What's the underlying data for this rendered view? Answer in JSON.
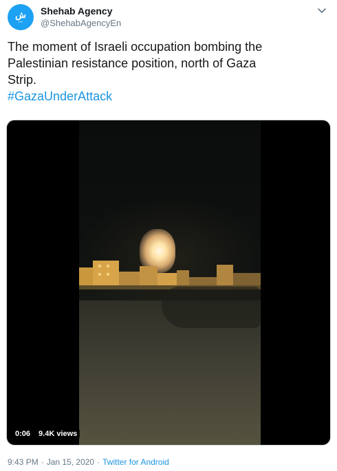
{
  "author": {
    "name": "Shehab Agency",
    "handle": "@ShehabAgencyEn",
    "avatar_icon": "shehab-logo-icon",
    "avatar_color": "#1da1f2"
  },
  "more_icon": "chevron-down-icon",
  "tweet": {
    "lines": [
      "The moment of Israeli occupation bombing the",
      "Palestinian resistance position, north of Gaza",
      "Strip."
    ],
    "hashtag": "#GazaUnderAttack"
  },
  "media": {
    "type": "video",
    "duration": "0:06",
    "views": "9.4K views"
  },
  "meta": {
    "time": "9:43 PM",
    "separator": "·",
    "date": "Jan 15, 2020",
    "source": "Twitter for Android"
  },
  "colors": {
    "link": "#1b95e0",
    "secondary_text": "#657786",
    "primary_text": "#14171a"
  }
}
